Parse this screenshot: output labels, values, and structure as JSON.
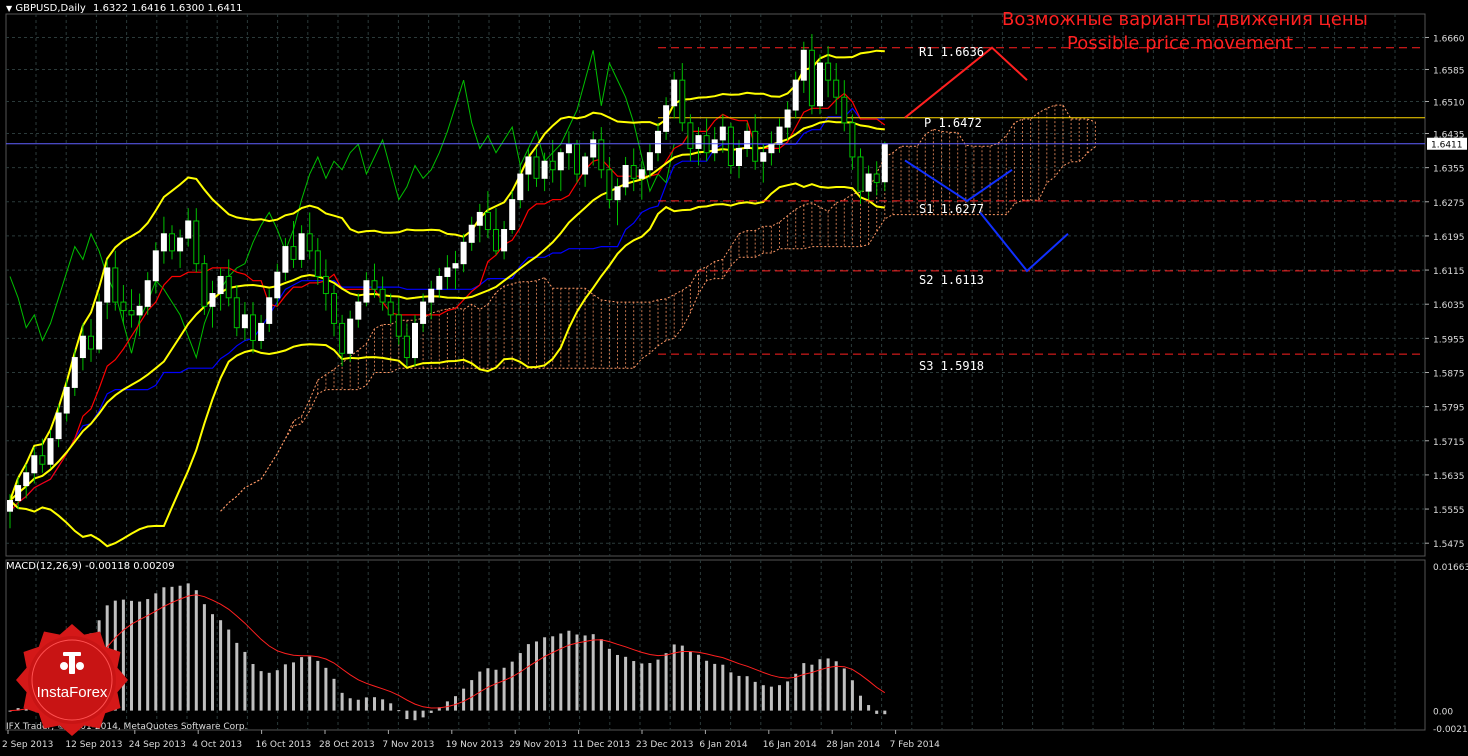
{
  "chart_data": [
    {
      "type": "candlestick",
      "symbol": "GBPUSD,Daily",
      "ohlc": "1.6322 1.6416 1.6300 1.6411",
      "title_ru": "Возможные варианты движения цены",
      "title_en": "Possible price movement",
      "last_price": "1.6411",
      "y_ticks": [
        "1.6660",
        "1.6585",
        "1.6510",
        "1.6435",
        "1.6355",
        "1.6275",
        "1.6195",
        "1.6115",
        "1.6035",
        "1.5955",
        "1.5875",
        "1.5795",
        "1.5715",
        "1.5635",
        "1.5555",
        "1.5475"
      ],
      "x_ticks": [
        "2 Sep 2013",
        "12 Sep 2013",
        "24 Sep 2013",
        "4 Oct 2013",
        "16 Oct 2013",
        "28 Oct 2013",
        "7 Nov 2013",
        "19 Nov 2013",
        "29 Nov 2013",
        "11 Dec 2013",
        "23 Dec 2013",
        "6 Jan 2014",
        "16 Jan 2014",
        "28 Jan 2014",
        "7 Feb 2014"
      ],
      "ylim": [
        1.5445,
        1.6715
      ],
      "levels": [
        {
          "name": "R1",
          "value": 1.6636,
          "label": "R1  1.6636",
          "color": "#ff2020",
          "dash": "dashed"
        },
        {
          "name": "P",
          "value": 1.6472,
          "label": "P  1.6472",
          "color": "#ffd700",
          "dash": "solid"
        },
        {
          "name": "S1",
          "value": 1.6277,
          "label": "S1  1.6277",
          "color": "#ff2020",
          "dash": "dashed"
        },
        {
          "name": "S2",
          "value": 1.6113,
          "label": "S2  1.6113",
          "color": "#ff2020",
          "dash": "dashed"
        },
        {
          "name": "S3",
          "value": 1.5918,
          "label": "S3  1.5918",
          "color": "#ff2020",
          "dash": "dashed"
        }
      ],
      "candles": [
        [
          1.555,
          1.559,
          1.551,
          1.5575
        ],
        [
          1.5575,
          1.563,
          1.5555,
          1.561
        ],
        [
          1.561,
          1.566,
          1.558,
          1.564
        ],
        [
          1.564,
          1.57,
          1.5615,
          1.568
        ],
        [
          1.568,
          1.572,
          1.564,
          1.566
        ],
        [
          1.566,
          1.574,
          1.565,
          1.572
        ],
        [
          1.572,
          1.58,
          1.57,
          1.578
        ],
        [
          1.578,
          1.586,
          1.576,
          1.584
        ],
        [
          1.584,
          1.593,
          1.582,
          1.591
        ],
        [
          1.591,
          1.599,
          1.588,
          1.596
        ],
        [
          1.596,
          1.6,
          1.59,
          1.593
        ],
        [
          1.593,
          1.606,
          1.592,
          1.604
        ],
        [
          1.604,
          1.614,
          1.6,
          1.612
        ],
        [
          1.612,
          1.616,
          1.602,
          1.604
        ],
        [
          1.604,
          1.608,
          1.599,
          1.602
        ],
        [
          1.602,
          1.607,
          1.598,
          1.601
        ],
        [
          1.601,
          1.606,
          1.596,
          1.603
        ],
        [
          1.603,
          1.611,
          1.601,
          1.609
        ],
        [
          1.609,
          1.618,
          1.606,
          1.616
        ],
        [
          1.616,
          1.624,
          1.613,
          1.62
        ],
        [
          1.62,
          1.622,
          1.614,
          1.616
        ],
        [
          1.616,
          1.621,
          1.612,
          1.619
        ],
        [
          1.619,
          1.626,
          1.617,
          1.623
        ],
        [
          1.623,
          1.626,
          1.611,
          1.613
        ],
        [
          1.613,
          1.615,
          1.601,
          1.603
        ],
        [
          1.603,
          1.609,
          1.598,
          1.606
        ],
        [
          1.606,
          1.612,
          1.602,
          1.61
        ],
        [
          1.61,
          1.614,
          1.603,
          1.605
        ],
        [
          1.605,
          1.608,
          1.596,
          1.598
        ],
        [
          1.598,
          1.604,
          1.595,
          1.601
        ],
        [
          1.601,
          1.604,
          1.592,
          1.595
        ],
        [
          1.595,
          1.601,
          1.593,
          1.599
        ],
        [
          1.599,
          1.607,
          1.597,
          1.605
        ],
        [
          1.605,
          1.613,
          1.603,
          1.611
        ],
        [
          1.611,
          1.619,
          1.609,
          1.617
        ],
        [
          1.617,
          1.623,
          1.612,
          1.614
        ],
        [
          1.614,
          1.622,
          1.612,
          1.62
        ],
        [
          1.62,
          1.625,
          1.614,
          1.616
        ],
        [
          1.616,
          1.619,
          1.608,
          1.61
        ],
        [
          1.61,
          1.614,
          1.602,
          1.606
        ],
        [
          1.606,
          1.608,
          1.596,
          1.599
        ],
        [
          1.599,
          1.601,
          1.589,
          1.592
        ],
        [
          1.592,
          1.602,
          1.59,
          1.6
        ],
        [
          1.6,
          1.606,
          1.598,
          1.604
        ],
        [
          1.604,
          1.611,
          1.603,
          1.609
        ],
        [
          1.609,
          1.613,
          1.605,
          1.607
        ],
        [
          1.607,
          1.61,
          1.602,
          1.604
        ],
        [
          1.604,
          1.606,
          1.599,
          1.601
        ],
        [
          1.601,
          1.605,
          1.594,
          1.596
        ],
        [
          1.596,
          1.599,
          1.589,
          1.591
        ],
        [
          1.591,
          1.601,
          1.589,
          1.599
        ],
        [
          1.599,
          1.606,
          1.597,
          1.604
        ],
        [
          1.604,
          1.609,
          1.6,
          1.607
        ],
        [
          1.607,
          1.612,
          1.605,
          1.61
        ],
        [
          1.61,
          1.615,
          1.607,
          1.612
        ],
        [
          1.612,
          1.616,
          1.607,
          1.613
        ],
        [
          1.613,
          1.62,
          1.611,
          1.618
        ],
        [
          1.618,
          1.624,
          1.616,
          1.622
        ],
        [
          1.622,
          1.627,
          1.618,
          1.625
        ],
        [
          1.625,
          1.63,
          1.619,
          1.621
        ],
        [
          1.621,
          1.626,
          1.615,
          1.616
        ],
        [
          1.616,
          1.623,
          1.614,
          1.621
        ],
        [
          1.621,
          1.63,
          1.62,
          1.628
        ],
        [
          1.628,
          1.636,
          1.626,
          1.634
        ],
        [
          1.634,
          1.64,
          1.63,
          1.638
        ],
        [
          1.638,
          1.64,
          1.631,
          1.633
        ],
        [
          1.633,
          1.639,
          1.63,
          1.637
        ],
        [
          1.637,
          1.642,
          1.632,
          1.635
        ],
        [
          1.635,
          1.64,
          1.63,
          1.639
        ],
        [
          1.639,
          1.644,
          1.635,
          1.641
        ],
        [
          1.641,
          1.642,
          1.632,
          1.634
        ],
        [
          1.634,
          1.639,
          1.631,
          1.638
        ],
        [
          1.638,
          1.644,
          1.636,
          1.642
        ],
        [
          1.642,
          1.645,
          1.633,
          1.635
        ],
        [
          1.635,
          1.638,
          1.626,
          1.628
        ],
        [
          1.628,
          1.633,
          1.622,
          1.631
        ],
        [
          1.631,
          1.638,
          1.629,
          1.636
        ],
        [
          1.636,
          1.64,
          1.63,
          1.633
        ],
        [
          1.633,
          1.637,
          1.628,
          1.635
        ],
        [
          1.635,
          1.641,
          1.633,
          1.639
        ],
        [
          1.639,
          1.646,
          1.637,
          1.644
        ],
        [
          1.644,
          1.652,
          1.642,
          1.65
        ],
        [
          1.65,
          1.658,
          1.647,
          1.656
        ],
        [
          1.656,
          1.66,
          1.644,
          1.646
        ],
        [
          1.646,
          1.648,
          1.637,
          1.64
        ],
        [
          1.64,
          1.645,
          1.636,
          1.643
        ],
        [
          1.643,
          1.647,
          1.637,
          1.639
        ],
        [
          1.639,
          1.645,
          1.637,
          1.642
        ],
        [
          1.642,
          1.648,
          1.639,
          1.645
        ],
        [
          1.645,
          1.646,
          1.634,
          1.636
        ],
        [
          1.636,
          1.642,
          1.633,
          1.64
        ],
        [
          1.64,
          1.646,
          1.638,
          1.644
        ],
        [
          1.644,
          1.648,
          1.635,
          1.637
        ],
        [
          1.637,
          1.641,
          1.632,
          1.639
        ],
        [
          1.639,
          1.644,
          1.636,
          1.641
        ],
        [
          1.641,
          1.647,
          1.639,
          1.645
        ],
        [
          1.645,
          1.651,
          1.642,
          1.649
        ],
        [
          1.649,
          1.658,
          1.647,
          1.656
        ],
        [
          1.656,
          1.665,
          1.653,
          1.663
        ],
        [
          1.663,
          1.6668,
          1.648,
          1.65
        ],
        [
          1.65,
          1.662,
          1.648,
          1.66
        ],
        [
          1.66,
          1.664,
          1.652,
          1.656
        ],
        [
          1.656,
          1.66,
          1.648,
          1.652
        ],
        [
          1.652,
          1.656,
          1.644,
          1.646
        ],
        [
          1.646,
          1.648,
          1.635,
          1.638
        ],
        [
          1.638,
          1.64,
          1.627,
          1.63
        ],
        [
          1.63,
          1.636,
          1.628,
          1.634
        ],
        [
          1.634,
          1.637,
          1.629,
          1.632
        ],
        [
          1.6322,
          1.6416,
          1.63,
          1.6411
        ]
      ],
      "forecast_paths": [
        {
          "color": "#ff2020",
          "points": [
            [
              1.642,
              1.6472
            ],
            [
              1.66,
              1.6636
            ],
            [
              1.656,
              1.656
            ]
          ]
        },
        {
          "color": "#1030ff",
          "points": [
            [
              1.642,
              1.6372
            ],
            [
              1.6277,
              1.6277
            ],
            [
              1.635,
              1.635
            ]
          ]
        },
        {
          "color": "#1030ff",
          "points": [
            [
              1.625,
              1.625
            ],
            [
              1.6113,
              1.6113
            ],
            [
              1.62,
              1.62
            ]
          ]
        }
      ]
    },
    {
      "type": "bar",
      "name": "MACD(12,26,9) -0.00118 0.00209",
      "y_ticks": [
        "0.01663",
        "0.00",
        "-0.00214"
      ],
      "ylim": [
        -0.00214,
        0.01663
      ],
      "signal_color": "#ff2020",
      "hist_color": "#c0c0c0"
    }
  ],
  "footer": {
    "copyright": "IFX Trader, © 2001-2014, MetaQuotes Software Corp."
  },
  "logo": {
    "text": "InstaForex"
  },
  "colors": {
    "grid": "#2b3a3a",
    "candle_up": "#ffffff",
    "wick": "#00c000",
    "bollinger": "#ffff00",
    "tenkan": "#ff0000",
    "kijun": "#0000ff",
    "chikou": "#00c000",
    "cloud": "#ff9966"
  }
}
